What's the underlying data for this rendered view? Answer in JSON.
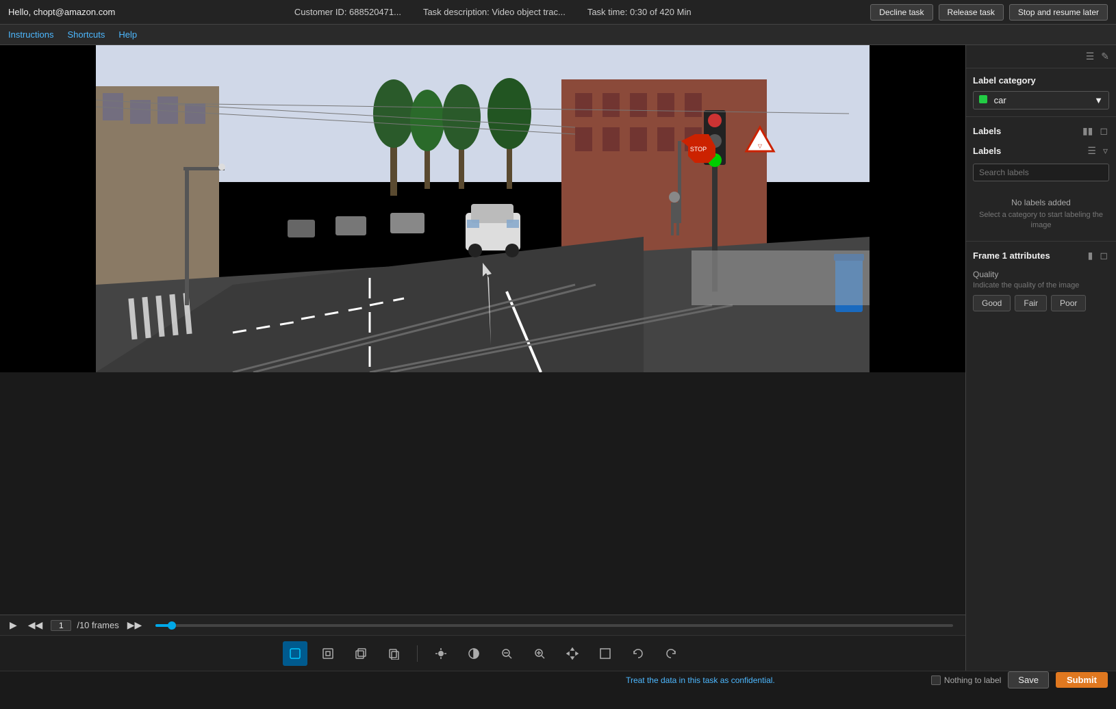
{
  "topbar": {
    "user": "Hello, chopt@amazon.com",
    "customer_id": "Customer ID: 688520471...",
    "task_description": "Task description: Video object trac...",
    "task_time": "Task time: 0:30 of 420 Min",
    "decline_btn": "Decline task",
    "release_btn": "Release task",
    "stop_btn": "Stop and resume later"
  },
  "navbar": {
    "instructions": "Instructions",
    "shortcuts": "Shortcuts",
    "help": "Help"
  },
  "right_panel": {
    "label_category_title": "Label category",
    "label_category_value": "car",
    "labels_section_title": "Labels",
    "labels_sub_title": "Labels",
    "search_placeholder": "Search labels",
    "no_labels_title": "No labels added",
    "no_labels_sub": "Select a category to start labeling the image",
    "frame_attrs_title": "Frame 1 attributes",
    "quality_label": "Quality",
    "quality_sub": "Indicate the quality of the image",
    "quality_good": "Good",
    "quality_fair": "Fair",
    "quality_poor": "Poor"
  },
  "timeline": {
    "frame_current": "1",
    "frame_total": "/10 frames"
  },
  "bottom": {
    "confidential_msg": "Treat the data in this task as confidential.",
    "nothing_to_label": "Nothing to label",
    "save_btn": "Save",
    "submit_btn": "Submit"
  },
  "colors": {
    "accent": "#00a8e8",
    "orange": "#e07820",
    "green": "#22cc44"
  }
}
